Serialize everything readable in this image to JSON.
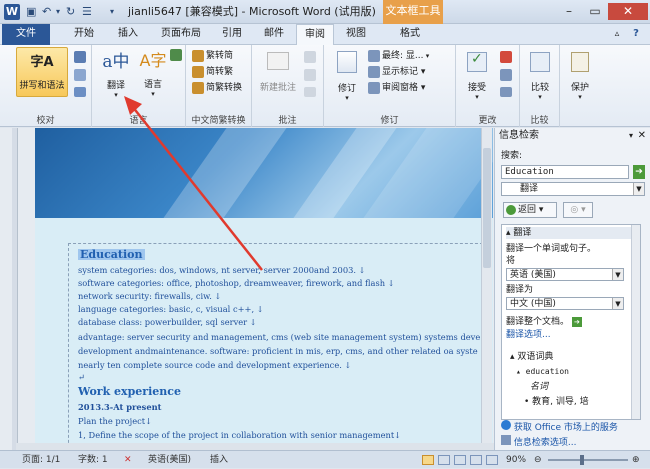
{
  "titlebar": {
    "word_icon": "W",
    "title": "jianli5647 [兼容模式] - Microsoft Word (试用版)",
    "context_tool": "文本框工具"
  },
  "tabs": [
    "文件",
    "开始",
    "插入",
    "页面布局",
    "引用",
    "邮件",
    "审阅",
    "视图",
    "格式"
  ],
  "ribbon": {
    "spelling": "拼写和语法",
    "translate": "翻译",
    "language": "语言",
    "proofing_label": "校对",
    "language_label": "语言",
    "trad_to_simp": "繁转简",
    "simp_to_trad": "简转繁",
    "simp_trad_convert": "简繁转换",
    "chinese_conv_label": "中文简繁转换",
    "new_comment": "新建批注",
    "comments_label": "批注",
    "track_changes": "修订",
    "final_display": "最终: 显...",
    "show_markup": "显示标记 ▾",
    "review_pane": "审阅窗格 ▾",
    "tracking_label": "修订",
    "accept": "接受",
    "changes_label": "更改",
    "compare": "比较",
    "compare_label": "比较",
    "protect": "保护"
  },
  "document": {
    "heading1": "Education",
    "lines1": [
      "system categories: dos, windows, nt server, server 2000and 2003. ↓",
      "software categories: office, photoshop, dreamweaver, firework, and flash ↓",
      "network security: firewalls, ciw. ↓",
      "language categories: basic, c, visual c++, ↓",
      "database class: powerbuilder, sql server ↓",
      "advantage: server security and management, cms (web site management system) systems deve",
      "development andmaintenance. software: proficient in mis, erp, cms, and other related oa syste",
      "nearly ten complete source code and development experience. ↓",
      "↵"
    ],
    "heading2": "Work experience",
    "date": "2013.3-At present",
    "lines2": [
      "Plan the project↓",
      "1, Define the scope of the project in  collaboration with senior management↓"
    ]
  },
  "pane": {
    "title": "信息检索",
    "search_label": "搜索:",
    "search_value": "Education",
    "source_value": "翻译",
    "back_label": "返回",
    "section_translate": "翻译",
    "translate_hint": "翻译一个单词或句子。",
    "from_label": "将",
    "from_lang": "英语 (美国)",
    "to_label": "翻译为",
    "to_lang": "中文 (中国)",
    "translate_doc": "翻译整个文档。",
    "translate_options": "翻译选项...",
    "dict_header": "双语词典",
    "dict_word": "education",
    "dict_def": "名词",
    "dict_def2": "教育, 训导, 培",
    "get_services": "获取 Office 市场上的服务",
    "research_options": "信息检索选项..."
  },
  "statusbar": {
    "page": "页面: 1/1",
    "words": "字数: 1",
    "lang": "英语(美国)",
    "mode": "插入",
    "zoom": "90%"
  },
  "colors": {
    "accent": "#2b5797",
    "context_tab": "#e8a04a",
    "arrow": "#e03a2e"
  }
}
